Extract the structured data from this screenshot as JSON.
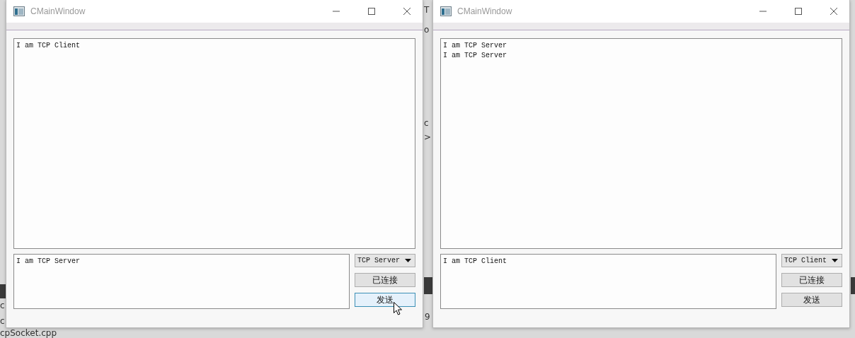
{
  "background_fragments": [
    {
      "text": "T"
    },
    {
      "text": "o"
    },
    {
      "text": "c"
    },
    {
      "text": ">"
    },
    {
      "text": "9"
    },
    {
      "text": "c"
    },
    {
      "text": "c"
    },
    {
      "text": "cpSocket.cpp"
    }
  ],
  "windows": [
    {
      "title": "CMainWindow",
      "output_lines": [
        "I am TCP Client"
      ],
      "input_text": "I am TCP Server",
      "mode": "TCP Server",
      "buttons": [
        {
          "label": "已连接",
          "hovered": false
        },
        {
          "label": "发送",
          "hovered": true
        }
      ]
    },
    {
      "title": "CMainWindow",
      "output_lines": [
        "I am TCP Server",
        "I am TCP Server"
      ],
      "input_text": "I am TCP Client",
      "mode": "TCP Client",
      "buttons": [
        {
          "label": "已连接",
          "hovered": false
        },
        {
          "label": "发送",
          "hovered": false
        }
      ]
    }
  ]
}
